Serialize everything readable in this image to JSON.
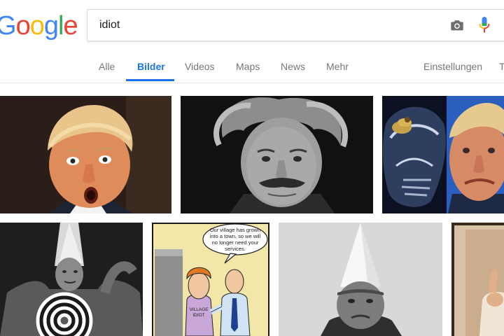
{
  "logo": {
    "letters": [
      "G",
      "o",
      "o",
      "g",
      "l",
      "e"
    ],
    "colors": [
      "#4285f4",
      "#ea4335",
      "#fbbc05",
      "#4285f4",
      "#34a853",
      "#ea4335"
    ]
  },
  "search": {
    "query": "idiot"
  },
  "icons": {
    "camera": "camera-icon",
    "mic": "microphone-icon"
  },
  "tabs": [
    {
      "label": "Alle"
    },
    {
      "label": "Bilder"
    },
    {
      "label": "Videos"
    },
    {
      "label": "Maps"
    },
    {
      "label": "News"
    },
    {
      "label": "Mehr"
    },
    {
      "label": "Einstellungen"
    },
    {
      "label": "T"
    }
  ],
  "active_tab": "Bilder",
  "results": {
    "tile4": {
      "bubble_lines": [
        "Our village has grown",
        "into a town, so we will",
        "no longer need your",
        "services."
      ],
      "shirt_lines": [
        "VILLAGE",
        "IDIOT"
      ]
    }
  },
  "colors": {
    "accent": "#1a73e8",
    "tab_text": "#777777"
  }
}
